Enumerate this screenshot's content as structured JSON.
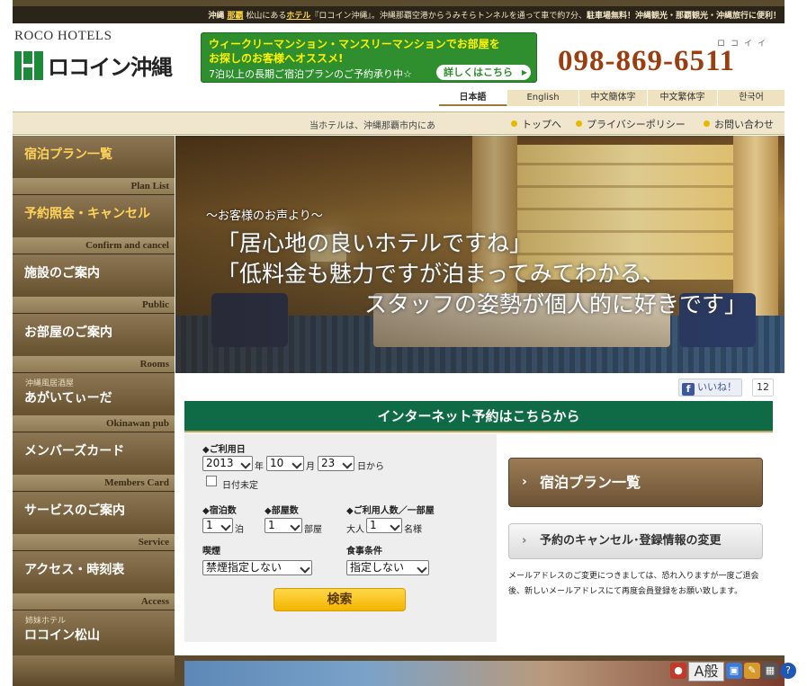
{
  "topbar": {
    "p1": "沖縄 ",
    "p2": "那覇",
    "p3": " 松山にある",
    "p4": "ホテル",
    "p5": "『ロコイン沖縄』。沖縄那覇空港からうみそらトンネルを通って車で約7分、",
    "p6": "駐車場無料！沖縄観光・那覇観光・沖縄旅行に便利！"
  },
  "header": {
    "logo_en": "ROCO HOTELS",
    "logo_jp": "ロコイン沖縄",
    "banner_line1": "ウィークリーマンション・マンスリーマンションでお部屋を",
    "banner_line2": "お探しのお客様へオススメ!",
    "banner_line3": "7泊以上の長期ご宿泊プランのご予約承り中☆",
    "banner_more": "詳しくはこちら",
    "tel_ruby": "ロコイイ",
    "tel": "098-869-6511"
  },
  "languages": [
    "日本語",
    "English",
    "中文簡体字",
    "中文繁体字",
    "한국어"
  ],
  "navbar": {
    "marquee": "当ホテルは、沖縄那覇市内にあ",
    "links": [
      "トップへ",
      "プライバシーポリシー",
      "お問い合わせ"
    ]
  },
  "sidebar": {
    "plan": {
      "jp": "宿泊プラン一覧",
      "en": "Plan List"
    },
    "confirm": {
      "jp": "予約照会・キャンセル",
      "en": "Confirm and cancel"
    },
    "public": {
      "jp": "施設のご案内",
      "en": "Public"
    },
    "rooms": {
      "jp": "お部屋のご案内",
      "en": "Rooms"
    },
    "pub": {
      "sub": "沖縄風居酒屋",
      "jp": "あがいてぃーだ",
      "en": "Okinawan pub"
    },
    "member": {
      "jp": "メンバーズカード",
      "en": "Members Card"
    },
    "service": {
      "jp": "サービスのご案内",
      "en": "Service"
    },
    "access": {
      "jp": "アクセス・時刻表",
      "en": "Access"
    },
    "sister": {
      "sub": "姉妹ホテル",
      "jp": "ロコイン松山"
    }
  },
  "hero": {
    "voice": "〜お客様のお声より〜",
    "q1": "「居心地の良いホテルですね」",
    "q2": "「低料金も魅力ですが泊まってみてわかる、",
    "q3": "スタッフの姿勢が個人的に好きです」"
  },
  "social": {
    "like": "いいね！",
    "count": "12",
    "fb": "f"
  },
  "reservation": {
    "header": "インターネット予約はこちらから",
    "date_label": "◆ご利用日",
    "year": "2013",
    "year_unit": "年",
    "month": "10",
    "month_unit": "月",
    "day": "23",
    "day_unit": "日から",
    "undecided": "日付未定",
    "nights_label": "◆宿泊数",
    "nights": "1",
    "nights_unit": "泊",
    "rooms_label": "◆部屋数",
    "rooms": "1",
    "rooms_unit": "部屋",
    "guests_label": "◆ご利用人数／一部屋",
    "guests_prefix": "大人",
    "guests": "1",
    "guests_unit": "名様",
    "smoking_label": "喫煙",
    "smoking": "禁煙指定しない",
    "meal_label": "食事条件",
    "meal": "指定しない",
    "search": "検索",
    "plan_button": "宿泊プラン一覧",
    "cancel_button": "予約のキャンセル･登録情報の変更",
    "note": "メールアドレスのご変更につきましては、恐れ入りますが一度ご退会後、新しいメールアドレスにて再度会員登録をお願い致します。"
  },
  "tray": {
    "ime": "A般",
    "help": "?"
  }
}
